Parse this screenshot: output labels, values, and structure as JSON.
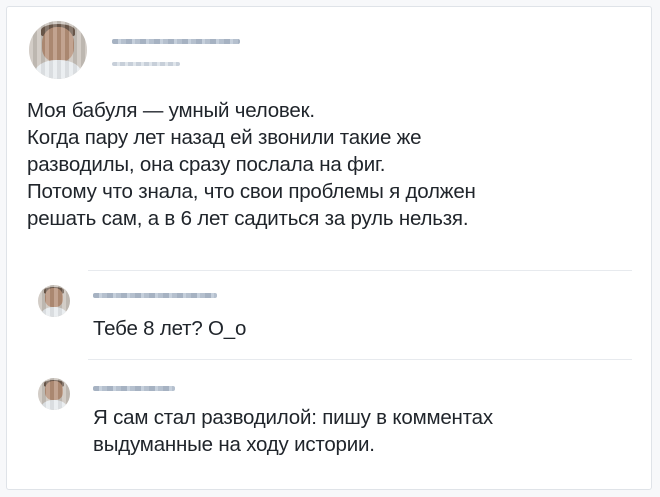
{
  "post": {
    "author_avatar_icon": "user-avatar-icon",
    "text": "Моя бабуля — умный человек.\nКогда пару лет назад ей звонили такие же\nразводилы, она сразу послала на фиг.\nПотому что знала, что свои проблемы я должен\nрешать сам, а в 6 лет садиться за руль нельзя."
  },
  "comments": [
    {
      "avatar_icon": "user-avatar-icon",
      "text": "Тебе 8 лет? О_о"
    },
    {
      "avatar_icon": "user-avatar-icon",
      "text": "Я сам стал разводилой: пишу в комментах\nвыдуманные на ходу истории."
    }
  ]
}
